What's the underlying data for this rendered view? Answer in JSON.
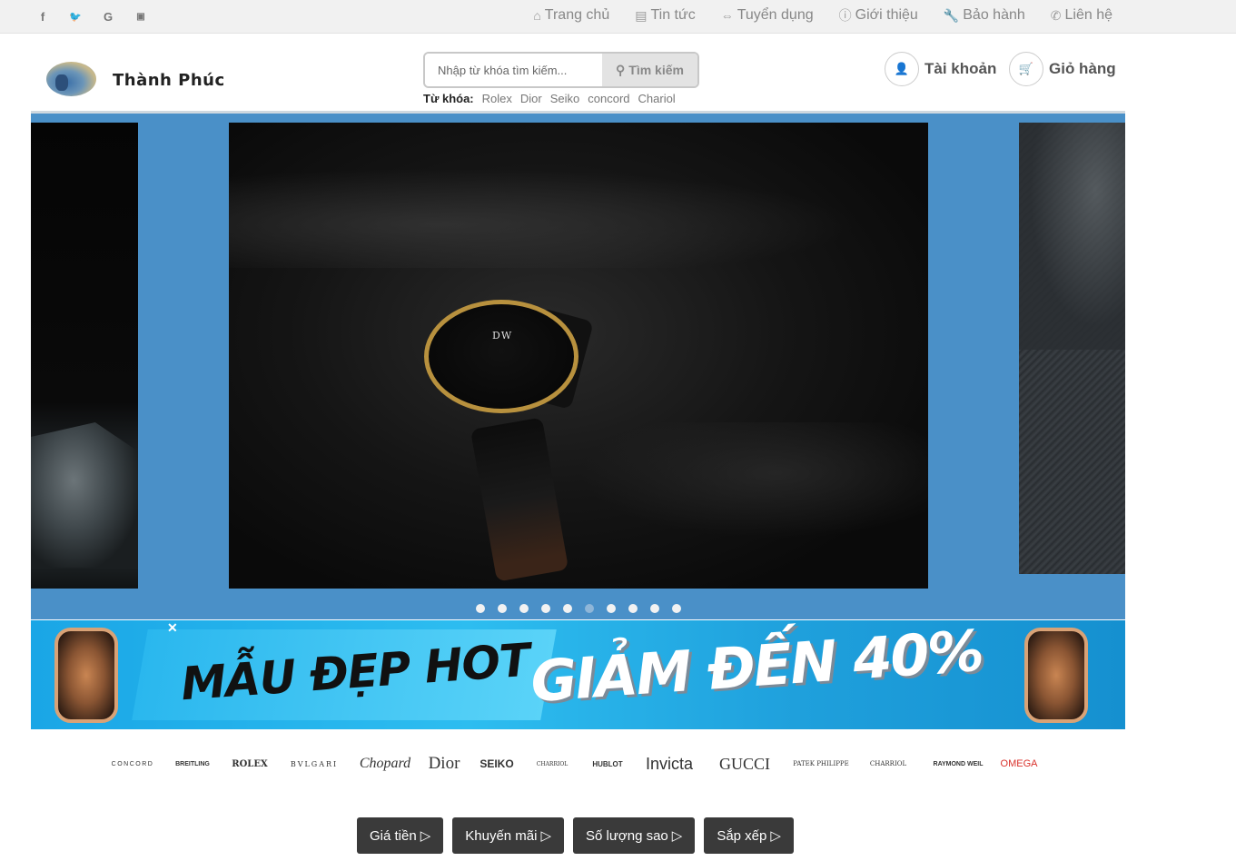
{
  "social": {
    "icons": [
      "facebook-icon",
      "twitter-icon",
      "google-icon",
      "youtube-icon"
    ],
    "glyphs": [
      "f",
      "🐦",
      "G",
      "▶"
    ]
  },
  "topnav": [
    {
      "label": "Trang chủ",
      "icon": "home-icon"
    },
    {
      "label": "Tin tức",
      "icon": "newspaper-icon"
    },
    {
      "label": "Tuyển dụng",
      "icon": "handshake-icon"
    },
    {
      "label": "Giới thiệu",
      "icon": "info-icon"
    },
    {
      "label": "Bảo hành",
      "icon": "wrench-icon"
    },
    {
      "label": "Liên hệ",
      "icon": "phone-icon"
    }
  ],
  "header": {
    "brand": "Thành Phúc",
    "search_placeholder": "Nhập từ khóa tìm kiếm...",
    "search_button": "Tìm kiếm",
    "keywords_label": "Từ khóa:",
    "keywords": [
      "Rolex",
      "Dior",
      "Seiko",
      "concord",
      "Chariol"
    ],
    "account_label": "Tài khoản",
    "cart_label": "Giỏ hàng"
  },
  "slider": {
    "dot_count": 10,
    "active_dot": 6,
    "watch_logo": "DW"
  },
  "banner": {
    "text_left": "MẪU ĐẸP HOT",
    "text_right": "GIẢM ĐẾN 40%"
  },
  "brands": [
    "CONCORD",
    "BREITLING",
    "ROLEX",
    "BVLGARI",
    "Chopard",
    "Dior",
    "SEIKO",
    "CHARRIOL",
    "HUBLOT",
    "Invicta",
    "GUCCI",
    "PATEK PHILIPPE",
    "CHARRIOL",
    "RAYMOND WEIL",
    "OMEGA"
  ],
  "filters": [
    {
      "label": "Giá tiền"
    },
    {
      "label": "Khuyến mãi"
    },
    {
      "label": "Số lượng sao"
    },
    {
      "label": "Sắp xếp"
    }
  ],
  "colors": {
    "slider_bg": "#4a90c8",
    "filter_bg": "#3a3a3a",
    "banner_bg": "#1aa6e6"
  }
}
